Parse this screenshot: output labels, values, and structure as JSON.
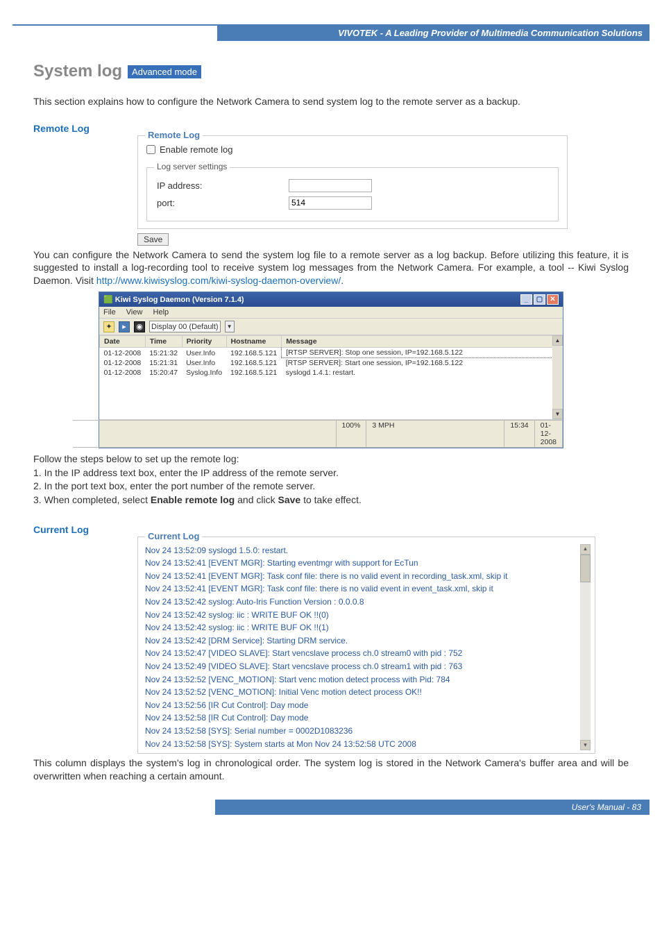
{
  "header": {
    "brand": "VIVOTEK - A Leading Provider of Multimedia Communication Solutions"
  },
  "title": {
    "main": "System log",
    "badge": "Advanced mode"
  },
  "intro": "This section explains how to configure the Network Camera to send system log to the remote server as a backup.",
  "remote_log": {
    "heading": "Remote Log",
    "panel_legend": "Remote Log",
    "enable_label": "Enable remote log",
    "settings_legend": "Log server settings",
    "ip_label": "IP address:",
    "ip_value": "",
    "port_label": "port:",
    "port_value": "514",
    "save_btn": "Save",
    "para_plain": "You can configure the Network Camera to send the system log file to a remote server as a log backup. Before utilizing this feature, it is suggested to install a log-recording tool to receive system log messages from the Network Camera. For example, a tool -- Kiwi Syslog Daemon. Visit ",
    "link_text": "http://www.kiwisyslog.com/kiwi-syslog-daemon-overview/",
    "para_end": "."
  },
  "kiwi": {
    "title": "Kiwi Syslog Daemon (Version 7.1.4)",
    "menu": {
      "file": "File",
      "view": "View",
      "help": "Help"
    },
    "display_label": "Display 00 (Default)",
    "columns": {
      "date": "Date",
      "time": "Time",
      "priority": "Priority",
      "hostname": "Hostname",
      "message": "Message"
    },
    "rows": [
      {
        "date": "01-12-2008",
        "time": "15:21:32",
        "priority": "User.Info",
        "hostname": "192.168.5.121",
        "message": "[RTSP SERVER]: Stop one session, IP=192.168.5.122"
      },
      {
        "date": "01-12-2008",
        "time": "15:21:31",
        "priority": "User.Info",
        "hostname": "192.168.5.121",
        "message": "[RTSP SERVER]: Start one session, IP=192.168.5.122"
      },
      {
        "date": "01-12-2008",
        "time": "15:20:47",
        "priority": "Syslog.Info",
        "hostname": "192.168.5.121",
        "message": "syslogd 1.4.1: restart."
      }
    ],
    "status": {
      "pct": "100%",
      "mph": "3 MPH",
      "time": "15:34",
      "date": "01-12-2008"
    }
  },
  "steps": {
    "lead": "Follow the steps below to set up the remote log:",
    "s1": "1. In the IP address text box, enter the IP address of the remote server.",
    "s2": "2. In the port text box, enter the port number of the remote server.",
    "s3_a": "3. When completed, select ",
    "s3_b": "Enable remote log",
    "s3_c": " and click ",
    "s3_d": "Save",
    "s3_e": " to take effect."
  },
  "current_log": {
    "heading": "Current Log",
    "panel_legend": "Current Log",
    "lines": [
      "Nov 24 13:52:09 syslogd 1.5.0: restart.",
      "Nov 24 13:52:41 [EVENT MGR]: Starting eventmgr with support for EcTun",
      "Nov 24 13:52:41 [EVENT MGR]: Task conf file: there is no valid event in recording_task.xml, skip it",
      "Nov 24 13:52:41 [EVENT MGR]: Task conf file: there is no valid event in event_task.xml, skip it",
      "Nov 24 13:52:42 syslog: Auto-Iris Function Version : 0.0.0.8",
      "Nov 24 13:52:42 syslog: iic : WRITE BUF OK !!(0)",
      "Nov 24 13:52:42 syslog: iic : WRITE BUF OK !!(1)",
      "Nov 24 13:52:42 [DRM Service]: Starting DRM service.",
      "Nov 24 13:52:47 [VIDEO SLAVE]: Start vencslave process ch.0 stream0 with pid : 752",
      "Nov 24 13:52:49 [VIDEO SLAVE]: Start vencslave process ch.0 stream1 with pid : 763",
      "Nov 24 13:52:52 [VENC_MOTION]: Start venc motion detect process with Pid: 784",
      "Nov 24 13:52:52 [VENC_MOTION]: Initial Venc motion detect process OK!!",
      "Nov 24 13:52:56 [IR Cut Control]: Day mode",
      "Nov 24 13:52:58 [IR Cut Control]: Day mode",
      "Nov 24 13:52:58 [SYS]: Serial number = 0002D1083236",
      "Nov 24 13:52:58 [SYS]: System starts at Mon Nov 24 13:52:58 UTC 2008"
    ],
    "footer_para": "This column displays the system's log in chronological order. The system log is stored in the Network Camera's buffer area and will be overwritten when reaching a certain amount."
  },
  "footer": {
    "text": "User's Manual - 83"
  }
}
